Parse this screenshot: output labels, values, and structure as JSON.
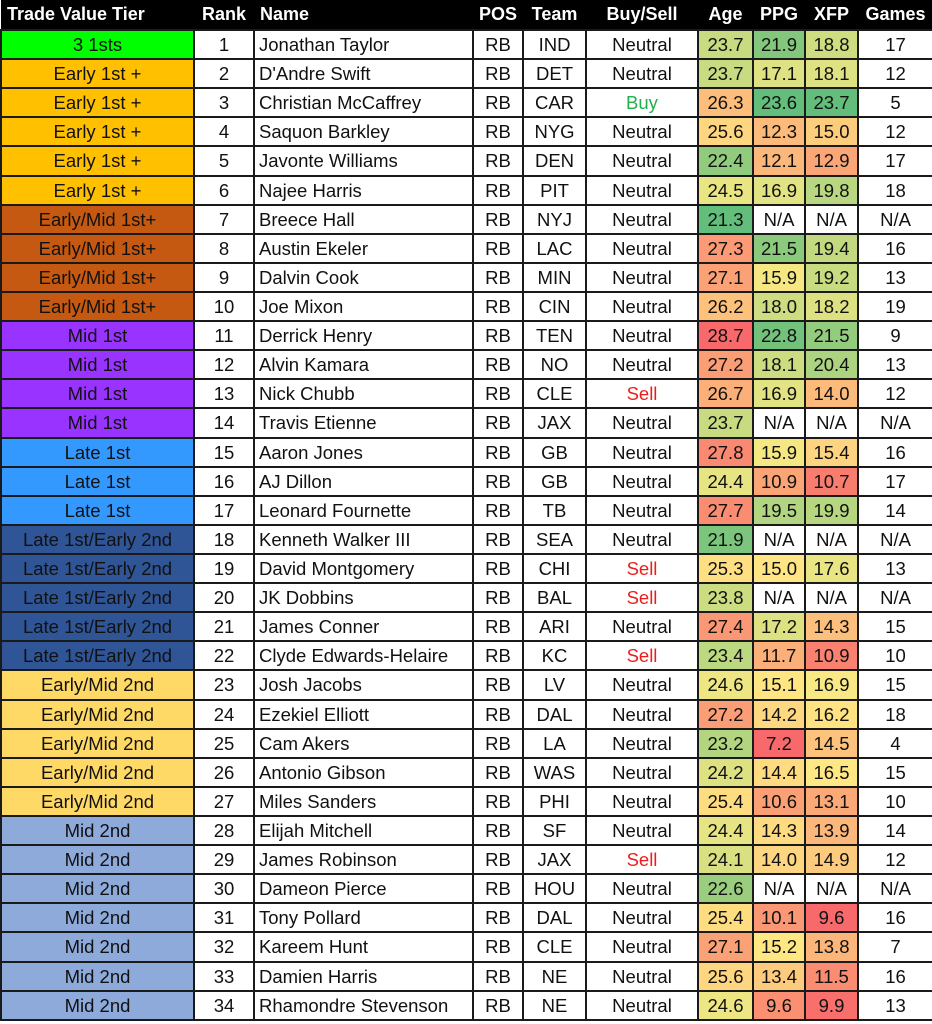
{
  "headers": {
    "tier": "Trade Value Tier",
    "rank": "Rank",
    "name": "Name",
    "pos": "POS",
    "team": "Team",
    "buy_sell": "Buy/Sell",
    "age": "Age",
    "ppg": "PPG",
    "xfp": "XFP",
    "games": "Games"
  },
  "colors": {
    "tiers": {
      "3 1sts": "#00ff00",
      "Early 1st +": "#ffc000",
      "Early/Mid 1st+": "#c65911",
      "Mid 1st": "#9933ff",
      "Late 1st": "#3399ff",
      "Late 1st/Early 2nd": "#2f5597",
      "Early/Mid 2nd": "#ffd966",
      "Mid 2nd": "#8eaadb"
    },
    "buy": "#22b04c",
    "sell": "#ee1c1c",
    "scale_low": "#f8696b",
    "scale_mid": "#ffeb84",
    "scale_high": "#63be7b",
    "na_background": "#ffffff"
  },
  "rows": [
    {
      "tier": "3 1sts",
      "rank": "1",
      "name": "Jonathan Taylor",
      "pos": "RB",
      "team": "IND",
      "buy_sell": "Neutral",
      "age": "23.7",
      "ppg": "21.9",
      "xfp": "18.8",
      "games": "17"
    },
    {
      "tier": "Early 1st +",
      "rank": "2",
      "name": "D'Andre Swift",
      "pos": "RB",
      "team": "DET",
      "buy_sell": "Neutral",
      "age": "23.7",
      "ppg": "17.1",
      "xfp": "18.1",
      "games": "12"
    },
    {
      "tier": "Early 1st +",
      "rank": "3",
      "name": "Christian McCaffrey",
      "pos": "RB",
      "team": "CAR",
      "buy_sell": "Buy",
      "age": "26.3",
      "ppg": "23.6",
      "xfp": "23.7",
      "games": "5"
    },
    {
      "tier": "Early 1st +",
      "rank": "4",
      "name": "Saquon Barkley",
      "pos": "RB",
      "team": "NYG",
      "buy_sell": "Neutral",
      "age": "25.6",
      "ppg": "12.3",
      "xfp": "15.0",
      "games": "12"
    },
    {
      "tier": "Early 1st +",
      "rank": "5",
      "name": "Javonte Williams",
      "pos": "RB",
      "team": "DEN",
      "buy_sell": "Neutral",
      "age": "22.4",
      "ppg": "12.1",
      "xfp": "12.9",
      "games": "17"
    },
    {
      "tier": "Early 1st +",
      "rank": "6",
      "name": "Najee Harris",
      "pos": "RB",
      "team": "PIT",
      "buy_sell": "Neutral",
      "age": "24.5",
      "ppg": "16.9",
      "xfp": "19.8",
      "games": "18"
    },
    {
      "tier": "Early/Mid 1st+",
      "rank": "7",
      "name": "Breece Hall",
      "pos": "RB",
      "team": "NYJ",
      "buy_sell": "Neutral",
      "age": "21.3",
      "ppg": "N/A",
      "xfp": "N/A",
      "games": "N/A"
    },
    {
      "tier": "Early/Mid 1st+",
      "rank": "8",
      "name": "Austin Ekeler",
      "pos": "RB",
      "team": "LAC",
      "buy_sell": "Neutral",
      "age": "27.3",
      "ppg": "21.5",
      "xfp": "19.4",
      "games": "16"
    },
    {
      "tier": "Early/Mid 1st+",
      "rank": "9",
      "name": "Dalvin Cook",
      "pos": "RB",
      "team": "MIN",
      "buy_sell": "Neutral",
      "age": "27.1",
      "ppg": "15.9",
      "xfp": "19.2",
      "games": "13"
    },
    {
      "tier": "Early/Mid 1st+",
      "rank": "10",
      "name": "Joe Mixon",
      "pos": "RB",
      "team": "CIN",
      "buy_sell": "Neutral",
      "age": "26.2",
      "ppg": "18.0",
      "xfp": "18.2",
      "games": "19"
    },
    {
      "tier": "Mid 1st",
      "rank": "11",
      "name": "Derrick Henry",
      "pos": "RB",
      "team": "TEN",
      "buy_sell": "Neutral",
      "age": "28.7",
      "ppg": "22.8",
      "xfp": "21.5",
      "games": "9"
    },
    {
      "tier": "Mid 1st",
      "rank": "12",
      "name": "Alvin Kamara",
      "pos": "RB",
      "team": "NO",
      "buy_sell": "Neutral",
      "age": "27.2",
      "ppg": "18.1",
      "xfp": "20.4",
      "games": "13"
    },
    {
      "tier": "Mid 1st",
      "rank": "13",
      "name": "Nick Chubb",
      "pos": "RB",
      "team": "CLE",
      "buy_sell": "Sell",
      "age": "26.7",
      "ppg": "16.9",
      "xfp": "14.0",
      "games": "12"
    },
    {
      "tier": "Mid 1st",
      "rank": "14",
      "name": "Travis Etienne",
      "pos": "RB",
      "team": "JAX",
      "buy_sell": "Neutral",
      "age": "23.7",
      "ppg": "N/A",
      "xfp": "N/A",
      "games": "N/A"
    },
    {
      "tier": "Late 1st",
      "rank": "15",
      "name": "Aaron Jones",
      "pos": "RB",
      "team": "GB",
      "buy_sell": "Neutral",
      "age": "27.8",
      "ppg": "15.9",
      "xfp": "15.4",
      "games": "16"
    },
    {
      "tier": "Late 1st",
      "rank": "16",
      "name": "AJ Dillon",
      "pos": "RB",
      "team": "GB",
      "buy_sell": "Neutral",
      "age": "24.4",
      "ppg": "10.9",
      "xfp": "10.7",
      "games": "17"
    },
    {
      "tier": "Late 1st",
      "rank": "17",
      "name": "Leonard Fournette",
      "pos": "RB",
      "team": "TB",
      "buy_sell": "Neutral",
      "age": "27.7",
      "ppg": "19.5",
      "xfp": "19.9",
      "games": "14"
    },
    {
      "tier": "Late 1st/Early 2nd",
      "rank": "18",
      "name": "Kenneth Walker III",
      "pos": "RB",
      "team": "SEA",
      "buy_sell": "Neutral",
      "age": "21.9",
      "ppg": "N/A",
      "xfp": "N/A",
      "games": "N/A"
    },
    {
      "tier": "Late 1st/Early 2nd",
      "rank": "19",
      "name": "David Montgomery",
      "pos": "RB",
      "team": "CHI",
      "buy_sell": "Sell",
      "age": "25.3",
      "ppg": "15.0",
      "xfp": "17.6",
      "games": "13"
    },
    {
      "tier": "Late 1st/Early 2nd",
      "rank": "20",
      "name": "JK Dobbins",
      "pos": "RB",
      "team": "BAL",
      "buy_sell": "Sell",
      "age": "23.8",
      "ppg": "N/A",
      "xfp": "N/A",
      "games": "N/A"
    },
    {
      "tier": "Late 1st/Early 2nd",
      "rank": "21",
      "name": "James Conner",
      "pos": "RB",
      "team": "ARI",
      "buy_sell": "Neutral",
      "age": "27.4",
      "ppg": "17.2",
      "xfp": "14.3",
      "games": "15"
    },
    {
      "tier": "Late 1st/Early 2nd",
      "rank": "22",
      "name": "Clyde Edwards-Helaire",
      "pos": "RB",
      "team": "KC",
      "buy_sell": "Sell",
      "age": "23.4",
      "ppg": "11.7",
      "xfp": "10.9",
      "games": "10"
    },
    {
      "tier": "Early/Mid 2nd",
      "rank": "23",
      "name": "Josh Jacobs",
      "pos": "RB",
      "team": "LV",
      "buy_sell": "Neutral",
      "age": "24.6",
      "ppg": "15.1",
      "xfp": "16.9",
      "games": "15"
    },
    {
      "tier": "Early/Mid 2nd",
      "rank": "24",
      "name": "Ezekiel Elliott",
      "pos": "RB",
      "team": "DAL",
      "buy_sell": "Neutral",
      "age": "27.2",
      "ppg": "14.2",
      "xfp": "16.2",
      "games": "18"
    },
    {
      "tier": "Early/Mid 2nd",
      "rank": "25",
      "name": "Cam Akers",
      "pos": "RB",
      "team": "LA",
      "buy_sell": "Neutral",
      "age": "23.2",
      "ppg": "7.2",
      "xfp": "14.5",
      "games": "4"
    },
    {
      "tier": "Early/Mid 2nd",
      "rank": "26",
      "name": "Antonio Gibson",
      "pos": "RB",
      "team": "WAS",
      "buy_sell": "Neutral",
      "age": "24.2",
      "ppg": "14.4",
      "xfp": "16.5",
      "games": "15"
    },
    {
      "tier": "Early/Mid 2nd",
      "rank": "27",
      "name": "Miles Sanders",
      "pos": "RB",
      "team": "PHI",
      "buy_sell": "Neutral",
      "age": "25.4",
      "ppg": "10.6",
      "xfp": "13.1",
      "games": "10"
    },
    {
      "tier": "Mid 2nd",
      "rank": "28",
      "name": "Elijah Mitchell",
      "pos": "RB",
      "team": "SF",
      "buy_sell": "Neutral",
      "age": "24.4",
      "ppg": "14.3",
      "xfp": "13.9",
      "games": "14"
    },
    {
      "tier": "Mid 2nd",
      "rank": "29",
      "name": "James Robinson",
      "pos": "RB",
      "team": "JAX",
      "buy_sell": "Sell",
      "age": "24.1",
      "ppg": "14.0",
      "xfp": "14.9",
      "games": "12"
    },
    {
      "tier": "Mid 2nd",
      "rank": "30",
      "name": "Dameon Pierce",
      "pos": "RB",
      "team": "HOU",
      "buy_sell": "Neutral",
      "age": "22.6",
      "ppg": "N/A",
      "xfp": "N/A",
      "games": "N/A"
    },
    {
      "tier": "Mid 2nd",
      "rank": "31",
      "name": "Tony Pollard",
      "pos": "RB",
      "team": "DAL",
      "buy_sell": "Neutral",
      "age": "25.4",
      "ppg": "10.1",
      "xfp": "9.6",
      "games": "16"
    },
    {
      "tier": "Mid 2nd",
      "rank": "32",
      "name": "Kareem Hunt",
      "pos": "RB",
      "team": "CLE",
      "buy_sell": "Neutral",
      "age": "27.1",
      "ppg": "15.2",
      "xfp": "13.8",
      "games": "7"
    },
    {
      "tier": "Mid 2nd",
      "rank": "33",
      "name": "Damien Harris",
      "pos": "RB",
      "team": "NE",
      "buy_sell": "Neutral",
      "age": "25.6",
      "ppg": "13.4",
      "xfp": "11.5",
      "games": "16"
    },
    {
      "tier": "Mid 2nd",
      "rank": "34",
      "name": "Rhamondre Stevenson",
      "pos": "RB",
      "team": "NE",
      "buy_sell": "Neutral",
      "age": "24.6",
      "ppg": "9.6",
      "xfp": "9.9",
      "games": "13"
    }
  ]
}
